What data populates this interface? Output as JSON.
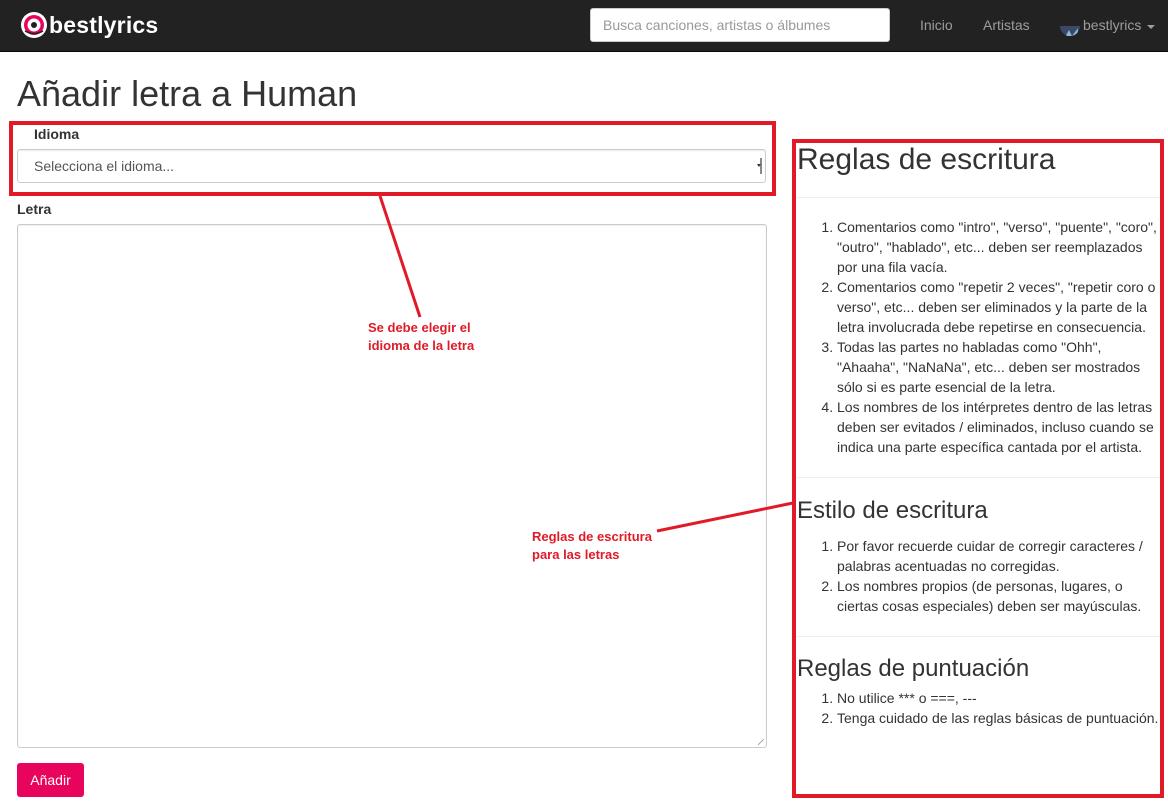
{
  "navbar": {
    "brand": "bestlyrics",
    "search_placeholder": "Busca canciones, artistas o álbumes",
    "links": [
      "Inicio",
      "Artistas"
    ],
    "user": "bestlyrics"
  },
  "page": {
    "title": "Añadir letra a Human"
  },
  "form": {
    "language_label": "Idioma",
    "language_value": "Selecciona el idioma...",
    "lyrics_label": "Letra",
    "submit_label": "Añadir"
  },
  "rules": {
    "writing_title": "Reglas de escritura",
    "writing_items": [
      "Comentarios como \"intro\", \"verso\", \"puente\", \"coro\", \"outro\", \"hablado\", etc... deben ser reemplazados por una fila vacía.",
      "Comentarios como \"repetir 2 veces\", \"repetir coro o verso\", etc... deben ser eliminados y la parte de la letra involucrada debe repetirse en consecuencia.",
      "Todas las partes no habladas como \"Ohh\", \"Ahaaha\", \"NaNaNa\", etc... deben ser mostrados sólo si es parte esencial de la letra.",
      "Los nombres de los intérpretes dentro de las letras deben ser evitados / eliminados, incluso cuando se indica una parte específica cantada por el artista."
    ],
    "style_title": "Estilo de escritura",
    "style_items": [
      "Por favor recuerde cuidar de corregir caracteres / palabras acentuadas no corregidas.",
      "Los nombres propios (de personas, lugares, o ciertas cosas especiales) deben ser mayúsculas."
    ],
    "punct_title": "Reglas de puntuación",
    "punct_items": [
      "No utilice *** o ===, ---",
      "Tenga cuidado de las reglas básicas de puntuación."
    ]
  },
  "annotations": {
    "language_note_line1": "Se debe elegir el",
    "language_note_line2": "idioma de la letra",
    "rules_note_line1": "Reglas de escritura",
    "rules_note_line2": "para las letras",
    "color": "#e11a28"
  },
  "colors": {
    "navbar_bg": "#222222",
    "accent": "#e8035c"
  }
}
